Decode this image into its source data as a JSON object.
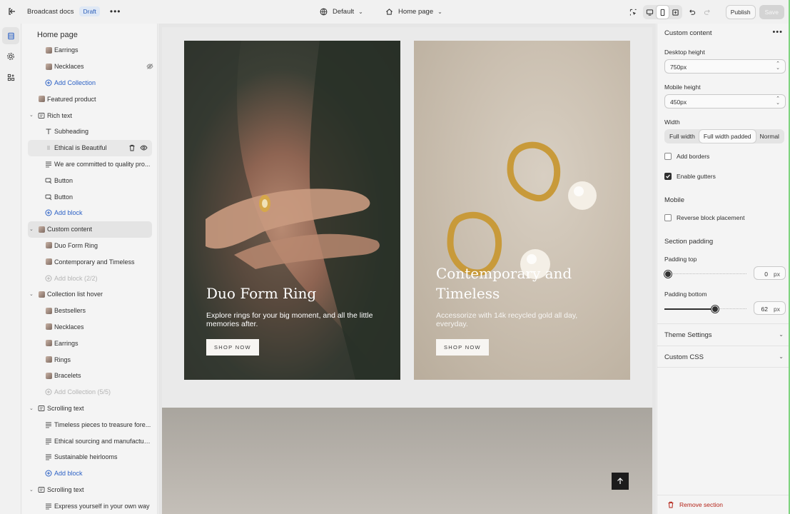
{
  "topbar": {
    "doc_title": "Broadcast docs",
    "status_badge": "Draft",
    "theme_select": "Default",
    "page_select": "Home page",
    "publish_label": "Publish",
    "save_label": "Save"
  },
  "sidebar": {
    "title": "Home page",
    "items": [
      {
        "label": "Earrings",
        "level": 2,
        "icon": "image-thumb-icon"
      },
      {
        "label": "Necklaces",
        "level": 2,
        "icon": "image-thumb-icon",
        "hidden": true
      },
      {
        "label": "Add Collection",
        "level": 2,
        "icon": "plus-circle-icon",
        "kind": "add"
      },
      {
        "label": "Featured product",
        "level": 1,
        "icon": "image-thumb-icon"
      },
      {
        "label": "Rich text",
        "level": 1,
        "icon": "section-icon",
        "expanded": true
      },
      {
        "label": "Subheading",
        "level": 2,
        "icon": "text-icon"
      },
      {
        "label": "Ethical is Beautiful",
        "level": 2,
        "icon": "drag-handle-icon",
        "hovered": true
      },
      {
        "label": "We are committed to quality pro...",
        "level": 2,
        "icon": "paragraph-icon"
      },
      {
        "label": "Button",
        "level": 2,
        "icon": "button-icon"
      },
      {
        "label": "Button",
        "level": 2,
        "icon": "button-icon"
      },
      {
        "label": "Add block",
        "level": 2,
        "icon": "plus-circle-icon",
        "kind": "add"
      },
      {
        "label": "Custom content",
        "level": 1,
        "icon": "image-thumb-icon",
        "expanded": true,
        "selected": true
      },
      {
        "label": "Duo Form Ring",
        "level": 2,
        "icon": "image-thumb-icon"
      },
      {
        "label": "Contemporary and Timeless",
        "level": 2,
        "icon": "image-thumb-icon"
      },
      {
        "label": "Add block (2/2)",
        "level": 2,
        "icon": "plus-circle-icon",
        "kind": "disabled"
      },
      {
        "label": "Collection list hover",
        "level": 1,
        "icon": "image-thumb-icon",
        "expanded": true
      },
      {
        "label": "Bestsellers",
        "level": 2,
        "icon": "image-thumb-icon"
      },
      {
        "label": "Necklaces",
        "level": 2,
        "icon": "image-thumb-icon"
      },
      {
        "label": "Earrings",
        "level": 2,
        "icon": "image-thumb-icon"
      },
      {
        "label": "Rings",
        "level": 2,
        "icon": "image-thumb-icon"
      },
      {
        "label": "Bracelets",
        "level": 2,
        "icon": "image-thumb-icon"
      },
      {
        "label": "Add Collection (5/5)",
        "level": 2,
        "icon": "plus-circle-icon",
        "kind": "disabled"
      },
      {
        "label": "Scrolling text",
        "level": 1,
        "icon": "section-icon",
        "expanded": true
      },
      {
        "label": "Timeless pieces to treasure fore...",
        "level": 2,
        "icon": "paragraph-icon"
      },
      {
        "label": "Ethical sourcing and manufacturi...",
        "level": 2,
        "icon": "paragraph-icon"
      },
      {
        "label": "Sustainable heirlooms",
        "level": 2,
        "icon": "paragraph-icon"
      },
      {
        "label": "Add block",
        "level": 2,
        "icon": "plus-circle-icon",
        "kind": "add"
      },
      {
        "label": "Scrolling text",
        "level": 1,
        "icon": "section-icon",
        "expanded": true
      },
      {
        "label": "Express yourself in your own way",
        "level": 2,
        "icon": "paragraph-icon"
      }
    ]
  },
  "preview": {
    "card1": {
      "title": "Duo Form Ring",
      "desc": "Explore rings for your big moment, and all the little memories after.",
      "button": "SHOP NOW"
    },
    "card2": {
      "title": "Contemporary and Timeless",
      "desc": "Accessorize with 14k recycled gold all day, everyday.",
      "button": "SHOP NOW"
    }
  },
  "panel": {
    "title": "Custom content",
    "desktop_height_label": "Desktop height",
    "desktop_height_value": "750px",
    "mobile_height_label": "Mobile height",
    "mobile_height_value": "450px",
    "width_label": "Width",
    "width_options": [
      "Full width",
      "Full width padded",
      "Normal"
    ],
    "width_selected": "Full width padded",
    "add_borders_label": "Add borders",
    "add_borders": false,
    "enable_gutters_label": "Enable gutters",
    "enable_gutters": true,
    "mobile_heading": "Mobile",
    "reverse_label": "Reverse block placement",
    "reverse": false,
    "padding_heading": "Section padding",
    "padding_top_label": "Padding top",
    "padding_top": "0",
    "padding_bottom_label": "Padding bottom",
    "padding_bottom": "62",
    "padding_max": 100,
    "unit": "px",
    "theme_settings": "Theme Settings",
    "custom_css": "Custom CSS",
    "remove_section": "Remove section"
  },
  "colors": {
    "accent": "#2c61c5",
    "danger": "#b42318",
    "badge_bg": "#dfe8f5"
  }
}
